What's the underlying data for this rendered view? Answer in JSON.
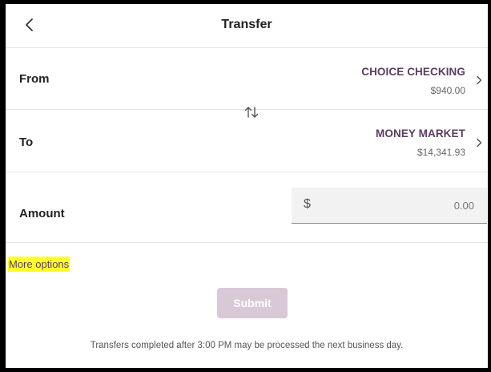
{
  "header": {
    "title": "Transfer",
    "back_icon": "chevron-left-icon"
  },
  "from": {
    "label": "From",
    "account_name": "CHOICE CHECKING",
    "balance": "$940.00"
  },
  "to": {
    "label": "To",
    "account_name": "MONEY MARKET",
    "balance": "$14,341.93"
  },
  "swap_icon": "swap-vertical-arrows-icon",
  "amount": {
    "label": "Amount",
    "currency_symbol": "$",
    "placeholder": "0.00",
    "value": ""
  },
  "more_options": "More options",
  "submit_label": "Submit",
  "footnote": "Transfers completed after 3:00 PM may be processed the next business day.",
  "colors": {
    "accent": "#5a3d60",
    "submit_disabled": "#d9c9d7",
    "highlight": "#ffff2a"
  }
}
